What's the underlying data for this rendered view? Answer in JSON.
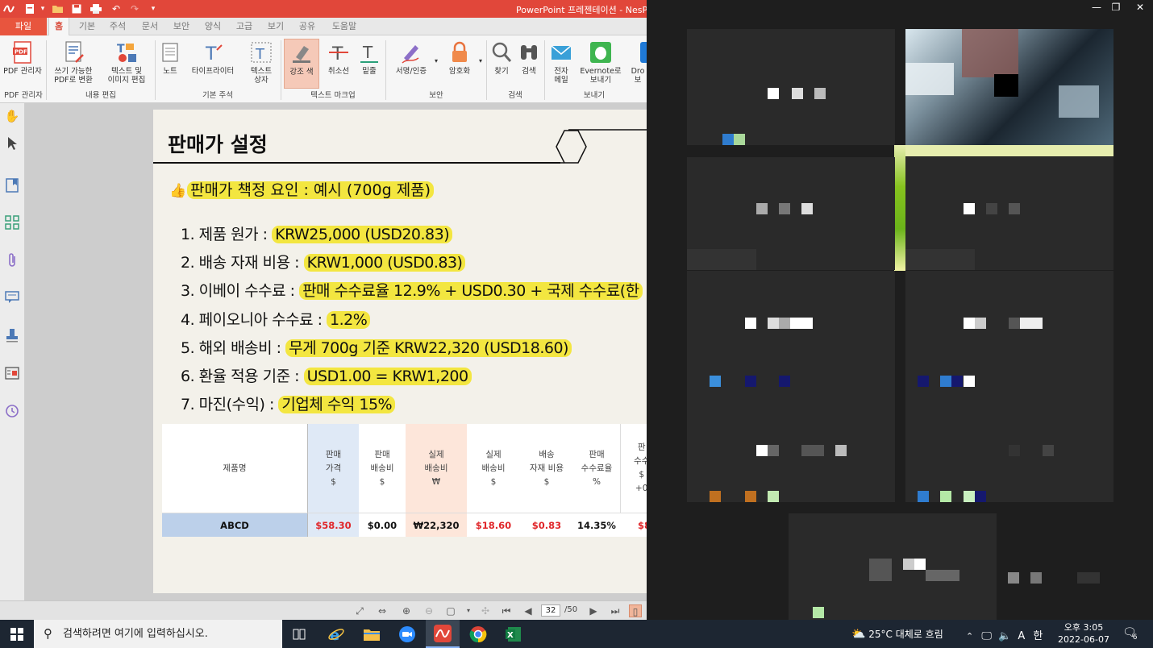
{
  "window": {
    "title": "PowerPoint 프레젠테이션 - NesPDF"
  },
  "tabs": {
    "file": "파일",
    "items": [
      "홈",
      "기본",
      "주석",
      "문서",
      "보안",
      "양식",
      "고급",
      "보기",
      "공유",
      "도움말"
    ],
    "active_index": 0
  },
  "ribbon": {
    "buttons": {
      "pdf_manager": "PDF 관리자",
      "convert_editable_1": "쓰기 가능한",
      "convert_editable_2": "PDF로 변환",
      "text_image_edit_1": "텍스트 및",
      "text_image_edit_2": "이미지 편집",
      "note": "노트",
      "typewriter": "타이프라이터",
      "textbox_1": "텍스트",
      "textbox_2": "상자",
      "highlight": "강조 색",
      "strikeout": "취소선",
      "underline": "밑줄",
      "sign_cert": "서명/인증",
      "encrypt": "암호화",
      "find": "찾기",
      "search": "검색",
      "email_1": "전자",
      "email_2": "메일",
      "evernote_1": "Evernote로",
      "evernote_2": "보내기",
      "dropbox_1": "Dro",
      "dropbox_2": "보"
    },
    "groups": {
      "pdf_manager": "PDF 관리자",
      "content_edit": "내용 편집",
      "basic_annot": "기본 주석",
      "text_markup": "텍스트 마크업",
      "security": "보안",
      "search": "검색",
      "send": "보내기"
    }
  },
  "slide": {
    "title": "판매가 설정",
    "factors_heading": "판매가 책정 요인 : 예시 (700g 제품)",
    "items": [
      {
        "label": "1. 제품 원가 : ",
        "value": "KRW25,000 (USD20.83)"
      },
      {
        "label": "2. 배송 자재 비용 : ",
        "value": "KRW1,000 (USD0.83)"
      },
      {
        "label": "3. 이베이 수수료 : ",
        "value": "판매 수수료율 12.9% + USD0.30 + 국제 수수료(한"
      },
      {
        "label": "4. 페이오니아 수수료 : ",
        "value": "1.2%"
      },
      {
        "label": "5. 해외 배송비 : ",
        "value": "무게 700g 기준 KRW22,320 (USD18.60)"
      },
      {
        "label": "6. 환율 적용 기준 : ",
        "value": "USD1.00 = KRW1,200"
      },
      {
        "label": "7. 마진(수익) : ",
        "value": "기업체 수익 15%"
      }
    ],
    "table": {
      "headers": [
        [
          "제품명"
        ],
        [
          "판매",
          "가격",
          "$"
        ],
        [
          "판매",
          "배송비",
          "$"
        ],
        [
          "실제",
          "배송비",
          "₩"
        ],
        [
          "실제",
          "배송비",
          "$"
        ],
        [
          "배송",
          "자재 비용",
          "$"
        ],
        [
          "판매",
          "수수료율",
          "%"
        ],
        [
          "판",
          "수수",
          "$",
          "+0"
        ]
      ],
      "row": [
        "ABCD",
        "$58.30",
        "$0.00",
        "₩22,320",
        "$18.60",
        "$0.83",
        "14.35%",
        "$8"
      ]
    }
  },
  "statusbar": {
    "current_page": "32",
    "total_pages": "/50"
  },
  "taskbar": {
    "search_placeholder": "검색하려면 여기에 입력하십시오.",
    "weather": "25°C  대체로 흐림",
    "ime": "한",
    "time": "오후 3:05",
    "date": "2022-06-07",
    "notifications": "6"
  },
  "colors": {
    "accent": "#e1473a",
    "highlight": "#f3e640",
    "red_value": "#e0262a",
    "price_header_bg": "#dfe9f6",
    "shipping_header_bg": "#fde6da",
    "name_row_bg": "#bcd0ea"
  }
}
